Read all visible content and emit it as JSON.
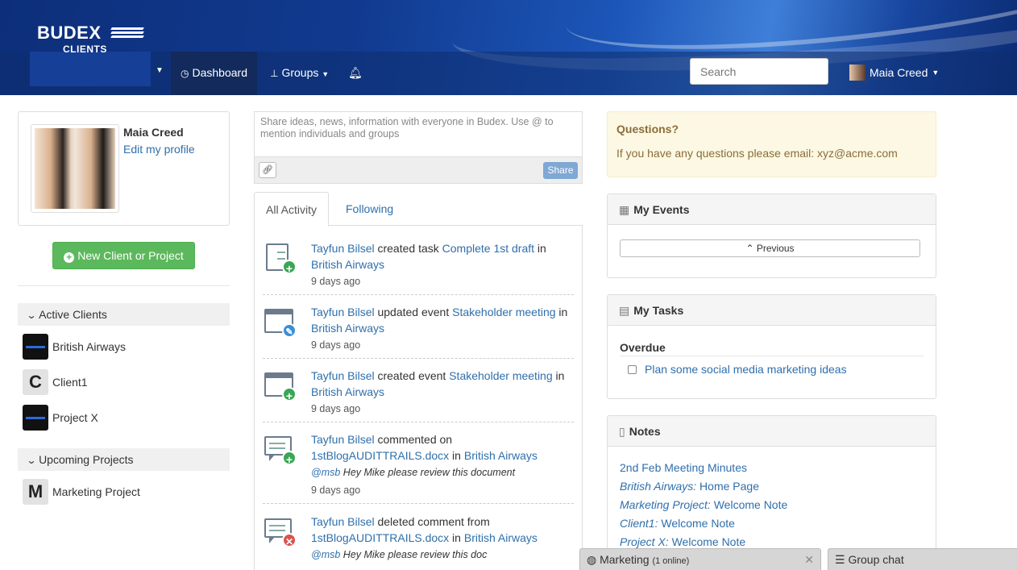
{
  "brand": {
    "line1": "BUDEX",
    "line2": "CLIENTS"
  },
  "nav": {
    "dashboard": "Dashboard",
    "groups": "Groups",
    "search_placeholder": "Search",
    "user_name": "Maia Creed"
  },
  "profile": {
    "name": "Maia Creed",
    "edit_label": "Edit my profile"
  },
  "new_button_label": "New Client or Project",
  "sidebar": {
    "active_clients_title": "Active Clients",
    "active_clients": [
      {
        "name": "British Airways"
      },
      {
        "name": "Client1",
        "letter": "C"
      },
      {
        "name": "Project X"
      }
    ],
    "upcoming_title": "Upcoming Projects",
    "upcoming": [
      {
        "name": "Marketing Project",
        "letter": "M"
      }
    ]
  },
  "share": {
    "placeholder": "Share ideas, news, information with everyone in Budex. Use @ to mention individuals and groups",
    "button": "Share"
  },
  "tabs": {
    "all": "All Activity",
    "following": "Following"
  },
  "feed": [
    {
      "actor": "Tayfun Bilsel",
      "verb": " created task ",
      "object": "Complete 1st draft",
      "prep": " in",
      "target": "British Airways",
      "time": "9 days ago"
    },
    {
      "actor": "Tayfun Bilsel",
      "verb": " updated event ",
      "object": "Stakeholder meeting",
      "prep": " in",
      "target": "British Airways",
      "time": "9 days ago"
    },
    {
      "actor": "Tayfun Bilsel",
      "verb": " created event ",
      "object": "Stakeholder meeting",
      "prep": " in",
      "target": "British Airways",
      "time": "9 days ago"
    },
    {
      "actor": "Tayfun Bilsel",
      "verb": " commented on",
      "object": "1stBlogAUDITTRAILS.docx",
      "prep": " in ",
      "target": "British Airways",
      "mention": "@msb",
      "comment": " Hey Mike please review this document",
      "time": "9 days ago"
    },
    {
      "actor": "Tayfun Bilsel",
      "verb": " deleted comment from",
      "object": "1stBlogAUDITTRAILS.docx",
      "prep": " in ",
      "target": "British Airways",
      "mention": "@msb",
      "comment": " Hey Mike please review this doc"
    }
  ],
  "questions": {
    "title": "Questions?",
    "message": "If you have any questions please email: xyz@acme.com"
  },
  "events": {
    "title": "My Events",
    "previous": "Previous"
  },
  "tasks": {
    "title": "My Tasks",
    "overdue": "Overdue",
    "item": "Plan some social media marketing ideas"
  },
  "notes": {
    "title": "Notes",
    "items": [
      {
        "prefix": "",
        "label": "2nd Feb Meeting Minutes"
      },
      {
        "prefix": "British Airways:",
        "label": " Home Page"
      },
      {
        "prefix": "Marketing Project:",
        "label": " Welcome Note"
      },
      {
        "prefix": "Client1:",
        "label": " Welcome Note"
      },
      {
        "prefix": "Project X:",
        "label": " Welcome Note"
      }
    ]
  },
  "chat": {
    "marketing": "Marketing",
    "marketing_status": "(1 online)",
    "group": "Group chat"
  }
}
